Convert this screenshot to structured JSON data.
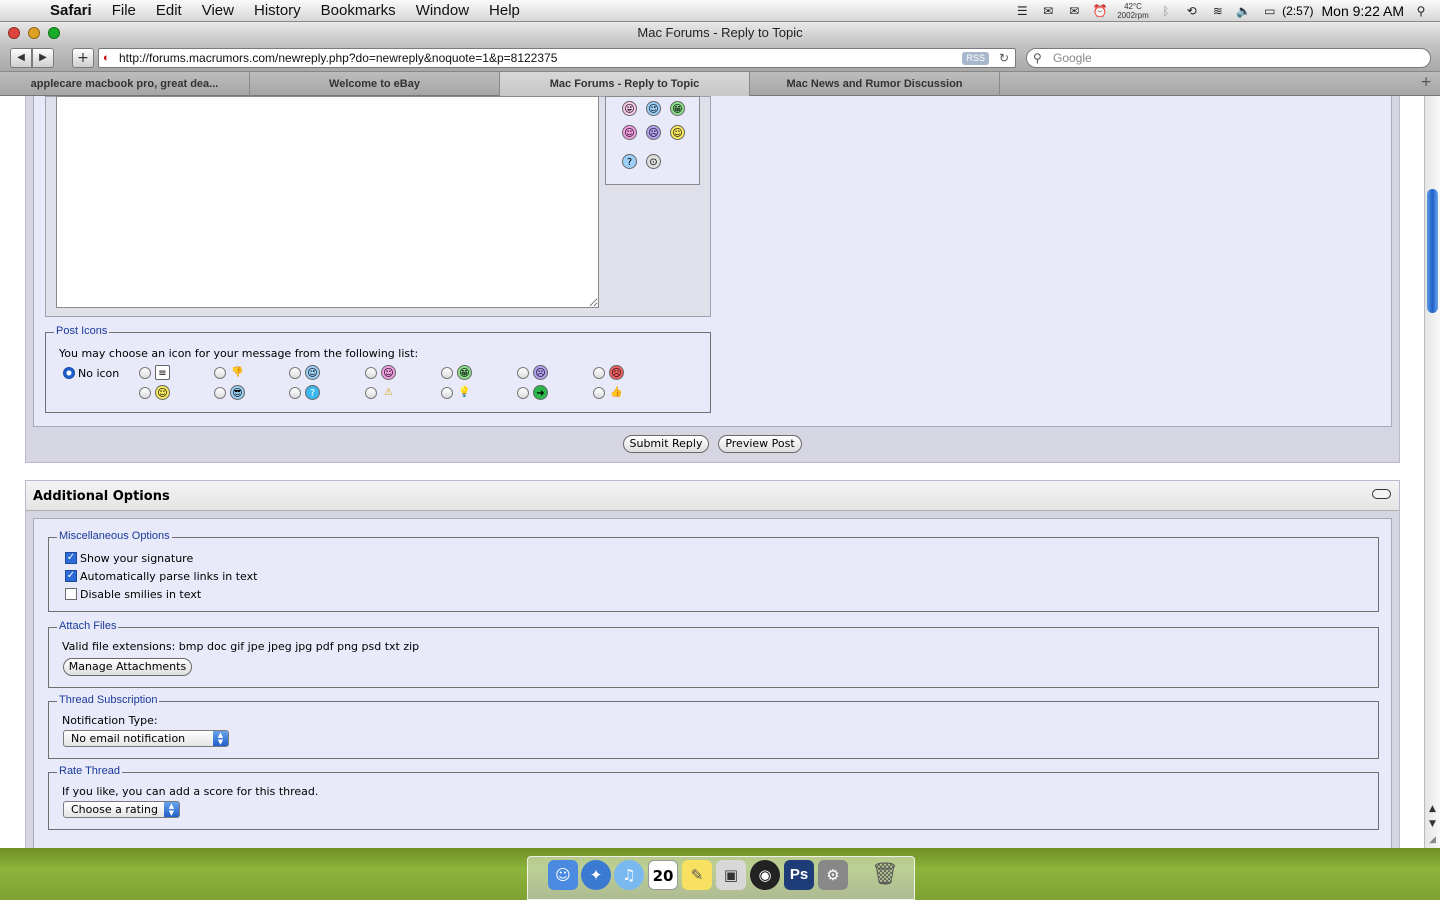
{
  "menubar": {
    "app": "Safari",
    "items": [
      "File",
      "Edit",
      "View",
      "History",
      "Bookmarks",
      "Window",
      "Help"
    ],
    "temp": "42°C",
    "rpm": "2002rpm",
    "battery": "(2:57)",
    "clock": "Mon 9:22 AM"
  },
  "window": {
    "title": "Mac Forums - Reply to Topic",
    "url": "http://forums.macrumors.com/newreply.php?do=newreply&noquote=1&p=8122375",
    "rss_label": "RSS",
    "search_placeholder": "Google"
  },
  "tabs": [
    {
      "label": "applecare macbook pro, great dea...",
      "active": false
    },
    {
      "label": "Welcome to eBay",
      "active": false
    },
    {
      "label": "Mac Forums - Reply to Topic",
      "active": true
    },
    {
      "label": "Mac News and Rumor Discussion",
      "active": false
    }
  ],
  "post_icons": {
    "legend": "Post Icons",
    "instruction": "You may choose an icon for your message from the following list:",
    "no_icon_label": "No icon",
    "selected": "No icon"
  },
  "buttons": {
    "submit": "Submit Reply",
    "preview": "Preview Post",
    "manage_attachments": "Manage Attachments"
  },
  "additional_options": {
    "title": "Additional Options",
    "misc": {
      "legend": "Miscellaneous Options",
      "options": [
        {
          "label": "Show your signature",
          "checked": true
        },
        {
          "label": "Automatically parse links in text",
          "checked": true
        },
        {
          "label": "Disable smilies in text",
          "checked": false
        }
      ]
    },
    "attach": {
      "legend": "Attach Files",
      "text": "Valid file extensions: bmp doc gif jpe jpeg jpg pdf png psd txt zip"
    },
    "subscription": {
      "legend": "Thread Subscription",
      "label": "Notification Type:",
      "selected": "No email notification"
    },
    "rate": {
      "legend": "Rate Thread",
      "text": "If you like, you can add a score for this thread.",
      "selected": "Choose a rating"
    }
  },
  "dock": {
    "calendar_day": "20"
  }
}
